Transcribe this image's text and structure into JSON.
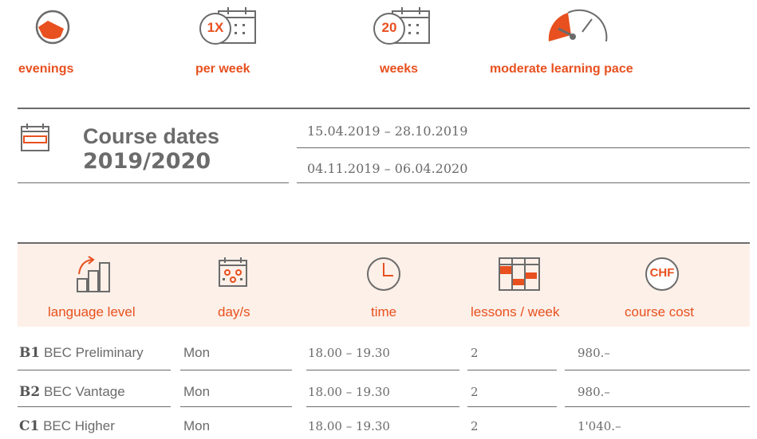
{
  "features": [
    {
      "icon": "half-clock-icon",
      "label": "evenings"
    },
    {
      "icon": "calendar-icon",
      "badge": "1X",
      "label": "per week"
    },
    {
      "icon": "calendar-icon",
      "badge": "20",
      "label": "weeks"
    },
    {
      "icon": "speedometer-icon",
      "label": "moderate learning pace"
    }
  ],
  "course_dates": {
    "title_line1": "Course dates",
    "title_line2": "2019/2020",
    "dates": [
      "15.04.2019 – 28.10.2019",
      "04.11.2019 – 06.04.2020"
    ]
  },
  "table": {
    "headers": [
      {
        "icon": "level-chart-icon",
        "label": "language level"
      },
      {
        "icon": "calendar-days-icon",
        "label": "day/s"
      },
      {
        "icon": "clock-icon",
        "label": "time"
      },
      {
        "icon": "schedule-grid-icon",
        "label": "lessons / week"
      },
      {
        "icon": "chf-icon",
        "label": "course cost",
        "badge": "CHF"
      }
    ],
    "rows": [
      {
        "level_code": "B1",
        "level_name": "BEC Preliminary",
        "days": "Mon",
        "time": "18.00 – 19.30",
        "lessons": "2",
        "cost": "980.–"
      },
      {
        "level_code": "B2",
        "level_name": "BEC Vantage",
        "days": "Mon",
        "time": "18.00 – 19.30",
        "lessons": "2",
        "cost": "980.–"
      },
      {
        "level_code": "C1",
        "level_name": "BEC Higher",
        "days": "Mon",
        "time": "18.00 – 19.30",
        "lessons": "2",
        "cost": "1'040.–"
      }
    ]
  },
  "colors": {
    "accent": "#e8501f",
    "text": "#6b6b6b",
    "band": "#fdf0e8"
  }
}
